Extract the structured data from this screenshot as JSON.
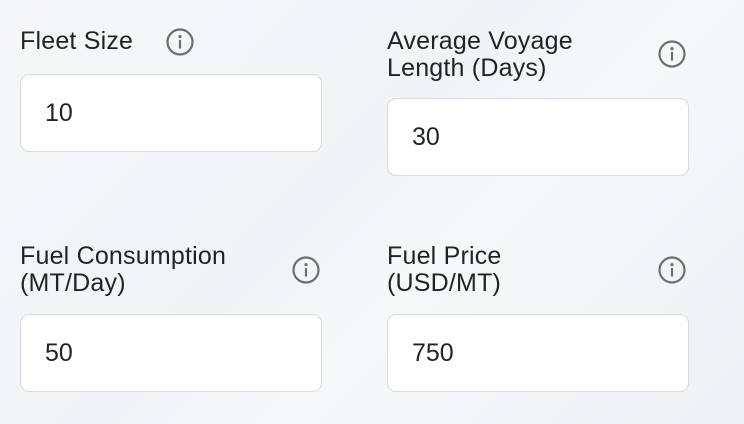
{
  "fields": [
    {
      "label": "Fleet Size",
      "value": "10",
      "info_icon": "info-icon"
    },
    {
      "label": "Average Voyage\nLength (Days)",
      "value": "30",
      "info_icon": "info-icon"
    },
    {
      "label": "Fuel Consumption\n(MT/Day)",
      "value": "50",
      "info_icon": "info-icon"
    },
    {
      "label": "Fuel Price\n(USD/MT)",
      "value": "750",
      "info_icon": "info-icon"
    }
  ],
  "colors": {
    "text": "#1f2328",
    "icon": "#6b6f75",
    "input_border": "#d7dade",
    "input_background": "#ffffff"
  }
}
